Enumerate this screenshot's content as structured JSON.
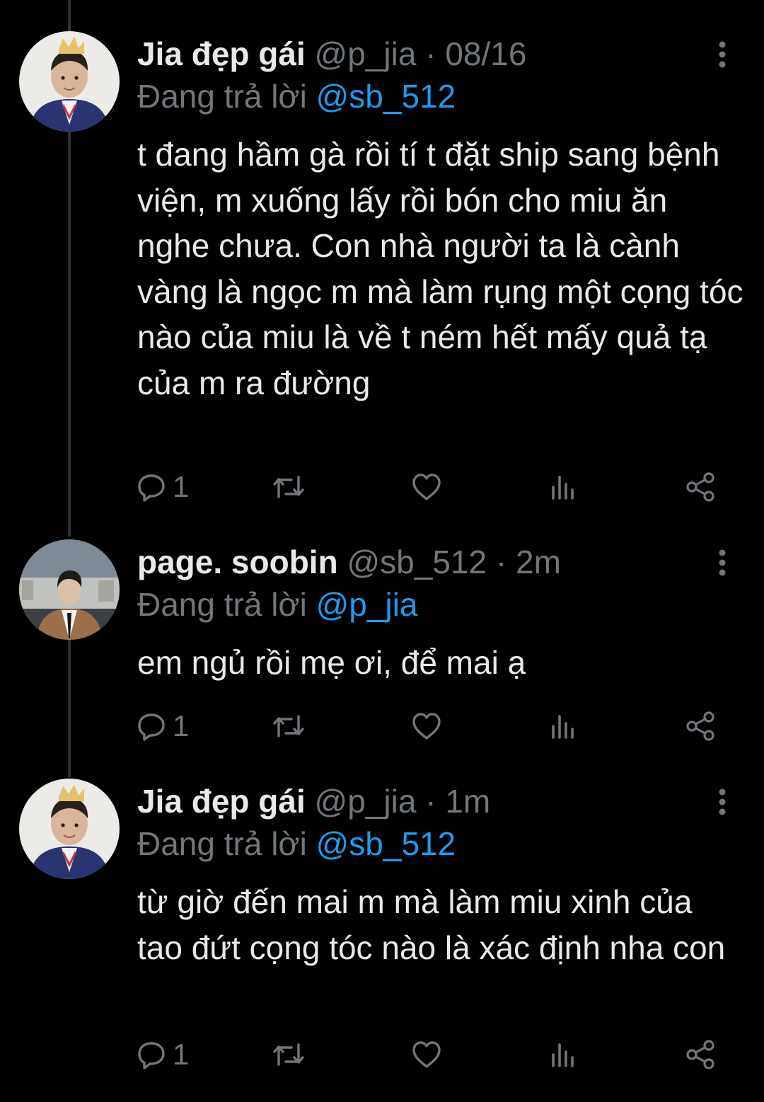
{
  "colors": {
    "background": "#000000",
    "text": "#e7e9ea",
    "muted": "#71767b",
    "accent": "#1d9bf0",
    "thread_line": "#2f3336"
  },
  "tweets": [
    {
      "display_name": "Jia đẹp gái",
      "handle": "@p_jia",
      "separator": "·",
      "time": "08/16",
      "reply_prefix": "Đang trả lời",
      "reply_to": "@sb_512",
      "text": "t đang hầm gà rồi tí t đặt ship sang bệnh viện, m xuống lấy rồi bón cho miu ăn nghe chưa. Con nhà người ta là cành vàng là ngọc m mà làm rụng một cọng tóc nào của miu là về t ném hết mấy quả tạ của m ra đường",
      "reply_count": "1",
      "avatar_icon": "child-avatar",
      "icons": [
        "reply-icon",
        "retweet-icon",
        "like-icon",
        "views-icon",
        "share-icon",
        "more-icon"
      ]
    },
    {
      "display_name": "page. soobin",
      "handle": "@sb_512",
      "separator": "·",
      "time": "2m",
      "reply_prefix": "Đang trả lời",
      "reply_to": "@p_jia",
      "text": "em ngủ rồi mẹ ơi, để mai ạ",
      "reply_count": "1",
      "avatar_icon": "man-avatar",
      "icons": [
        "reply-icon",
        "retweet-icon",
        "like-icon",
        "views-icon",
        "share-icon",
        "more-icon"
      ]
    },
    {
      "display_name": "Jia đẹp gái",
      "handle": "@p_jia",
      "separator": "·",
      "time": "1m",
      "reply_prefix": "Đang trả lời",
      "reply_to": "@sb_512",
      "text": "từ giờ đến mai m mà làm miu xinh của tao đứt cọng tóc nào là xác định nha con",
      "reply_count": "1",
      "avatar_icon": "child-avatar",
      "icons": [
        "reply-icon",
        "retweet-icon",
        "like-icon",
        "views-icon",
        "share-icon",
        "more-icon"
      ]
    }
  ]
}
